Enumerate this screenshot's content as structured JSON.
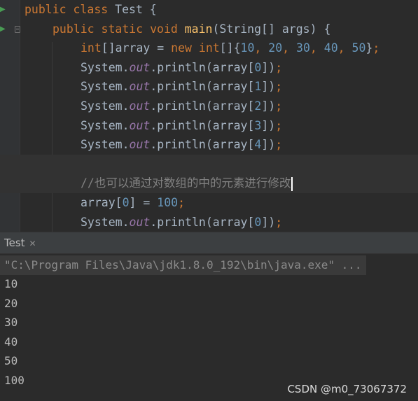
{
  "editor": {
    "lines": [
      {
        "tokens": [
          {
            "t": "public class ",
            "c": "kw"
          },
          {
            "t": "Test {",
            "c": "plain"
          }
        ]
      },
      {
        "tokens": [
          {
            "t": "public static void ",
            "c": "kw"
          },
          {
            "t": "main",
            "c": "fn"
          },
          {
            "t": "(String[] args) {",
            "c": "plain"
          }
        ]
      },
      {
        "tokens": [
          {
            "t": "int",
            "c": "kw"
          },
          {
            "t": "[]array = ",
            "c": "plain"
          },
          {
            "t": "new int",
            "c": "kw"
          },
          {
            "t": "[]{",
            "c": "plain"
          },
          {
            "t": "10",
            "c": "num"
          },
          {
            "t": ", ",
            "c": "kw"
          },
          {
            "t": "20",
            "c": "num"
          },
          {
            "t": ", ",
            "c": "kw"
          },
          {
            "t": "30",
            "c": "num"
          },
          {
            "t": ", ",
            "c": "kw"
          },
          {
            "t": "40",
            "c": "num"
          },
          {
            "t": ", ",
            "c": "kw"
          },
          {
            "t": "50",
            "c": "num"
          },
          {
            "t": "}",
            "c": "plain"
          },
          {
            "t": ";",
            "c": "kw"
          }
        ]
      },
      {
        "tokens": [
          {
            "t": "System.",
            "c": "plain"
          },
          {
            "t": "out",
            "c": "fld"
          },
          {
            "t": ".println(array[",
            "c": "plain"
          },
          {
            "t": "0",
            "c": "num"
          },
          {
            "t": "])",
            "c": "plain"
          },
          {
            "t": ";",
            "c": "kw"
          }
        ]
      },
      {
        "tokens": [
          {
            "t": "System.",
            "c": "plain"
          },
          {
            "t": "out",
            "c": "fld"
          },
          {
            "t": ".println(array[",
            "c": "plain"
          },
          {
            "t": "1",
            "c": "num"
          },
          {
            "t": "])",
            "c": "plain"
          },
          {
            "t": ";",
            "c": "kw"
          }
        ]
      },
      {
        "tokens": [
          {
            "t": "System.",
            "c": "plain"
          },
          {
            "t": "out",
            "c": "fld"
          },
          {
            "t": ".println(array[",
            "c": "plain"
          },
          {
            "t": "2",
            "c": "num"
          },
          {
            "t": "])",
            "c": "plain"
          },
          {
            "t": ";",
            "c": "kw"
          }
        ]
      },
      {
        "tokens": [
          {
            "t": "System.",
            "c": "plain"
          },
          {
            "t": "out",
            "c": "fld"
          },
          {
            "t": ".println(array[",
            "c": "plain"
          },
          {
            "t": "3",
            "c": "num"
          },
          {
            "t": "])",
            "c": "plain"
          },
          {
            "t": ";",
            "c": "kw"
          }
        ]
      },
      {
        "tokens": [
          {
            "t": "System.",
            "c": "plain"
          },
          {
            "t": "out",
            "c": "fld"
          },
          {
            "t": ".println(array[",
            "c": "plain"
          },
          {
            "t": "4",
            "c": "num"
          },
          {
            "t": "])",
            "c": "plain"
          },
          {
            "t": ";",
            "c": "kw"
          }
        ]
      },
      {
        "tokens": []
      },
      {
        "tokens": [
          {
            "t": "//也可以通过对数组的中的元素进行修改",
            "c": "cmt"
          }
        ]
      },
      {
        "tokens": [
          {
            "t": "array[",
            "c": "plain"
          },
          {
            "t": "0",
            "c": "num"
          },
          {
            "t": "] = ",
            "c": "plain"
          },
          {
            "t": "100",
            "c": "num"
          },
          {
            "t": ";",
            "c": "kw"
          }
        ]
      },
      {
        "tokens": [
          {
            "t": "System.",
            "c": "plain"
          },
          {
            "t": "out",
            "c": "fld"
          },
          {
            "t": ".println(array[",
            "c": "plain"
          },
          {
            "t": "0",
            "c": "num"
          },
          {
            "t": "])",
            "c": "plain"
          },
          {
            "t": ";",
            "c": "kw"
          }
        ]
      }
    ]
  },
  "run_panel": {
    "tab_label": "Test",
    "close_glyph": "✕"
  },
  "console": {
    "command": "\"C:\\Program Files\\Java\\jdk1.8.0_192\\bin\\java.exe\" ...",
    "output": [
      "10",
      "20",
      "30",
      "40",
      "50",
      "100"
    ]
  },
  "watermark": "CSDN @m0_73067372",
  "colors": {
    "keyword": "#cc7832",
    "method": "#ffc66d",
    "number": "#6897bb",
    "field": "#9876aa",
    "comment": "#808080",
    "text": "#a9b7c6"
  }
}
